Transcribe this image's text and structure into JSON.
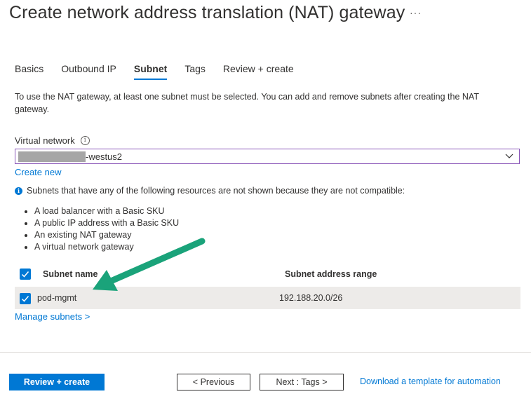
{
  "header": {
    "title": "Create network address translation (NAT) gateway",
    "more_label": "···"
  },
  "tabs": [
    {
      "label": "Basics",
      "active": false
    },
    {
      "label": "Outbound IP",
      "active": false
    },
    {
      "label": "Subnet",
      "active": true
    },
    {
      "label": "Tags",
      "active": false
    },
    {
      "label": "Review + create",
      "active": false
    }
  ],
  "description": "To use the NAT gateway, at least one subnet must be selected. You can add and remove subnets after creating the NAT gateway.",
  "virtual_network": {
    "label": "Virtual network",
    "info_glyph": "i",
    "value_suffix": "-westus2",
    "create_new_label": "Create new"
  },
  "notice": {
    "info_glyph": "i",
    "text": "Subnets that have any of the following resources are not shown because they are not compatible:",
    "items": [
      "A load balancer with a Basic SKU",
      "A public IP address with a Basic SKU",
      "An existing NAT gateway",
      "A virtual network gateway"
    ]
  },
  "subnet_table": {
    "columns": [
      "Subnet name",
      "Subnet address range"
    ],
    "rows": [
      {
        "name": "pod-mgmt",
        "range": "192.188.20.0/26",
        "checked": true
      }
    ],
    "manage_label": "Manage subnets >"
  },
  "footer": {
    "review_create_label": "Review + create",
    "previous_label": "< Previous",
    "next_label": "Next : Tags >",
    "download_label": "Download a template for automation"
  },
  "colors": {
    "accent": "#0078d4",
    "select_border": "#8a57b8",
    "arrow": "#1aa37a"
  },
  "icons": {
    "more": "more-icon",
    "info": "info-icon",
    "chevron": "chevron-down-icon",
    "check": "check-icon",
    "annotation": "annotation-arrow-icon"
  }
}
